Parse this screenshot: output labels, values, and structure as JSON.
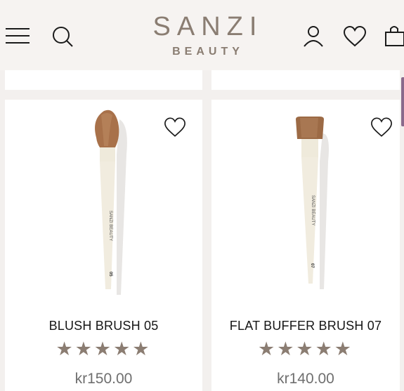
{
  "header": {
    "logo_main": "SANZI",
    "logo_sub": "BEAUTY",
    "icons": [
      "menu-icon",
      "search-icon",
      "account-icon",
      "wishlist-icon",
      "cart-icon"
    ]
  },
  "products": [
    {
      "name": "BLUSH BRUSH 05",
      "rating": 5,
      "stars": "★★★★★",
      "price": "kr150.00",
      "handle_text": "SANZI BEAUTY",
      "number": "05"
    },
    {
      "name": "FLAT BUFFER BRUSH 07",
      "rating": 5,
      "stars": "★★★★★",
      "price": "kr140.00",
      "handle_text": "SANZI BEAUTY",
      "number": "07"
    }
  ],
  "colors": {
    "brand": "#8a7d72",
    "star": "#8b7d72",
    "background": "#f3f0ee",
    "card": "#ffffff"
  }
}
